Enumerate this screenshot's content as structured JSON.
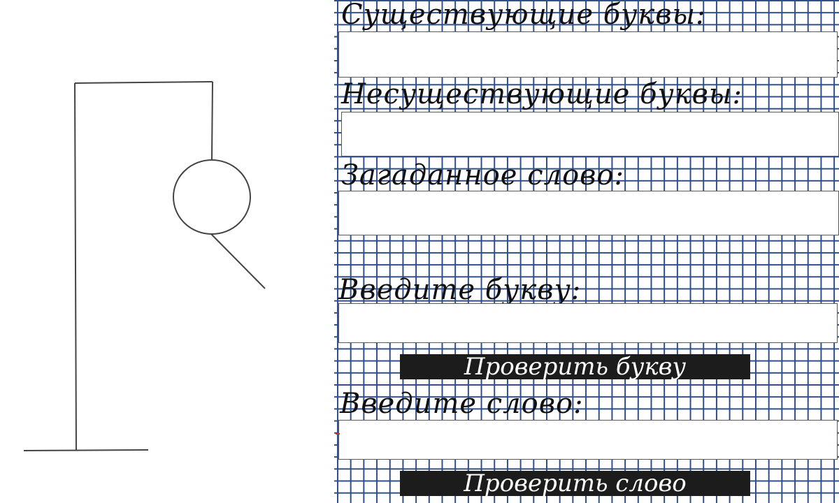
{
  "labels": {
    "existing_letters": "Существующие буквы:",
    "nonexisting_letters": "Несуществующие буквы:",
    "secret_word": "Загаданное слово:",
    "enter_letter": "Введите букву:",
    "enter_word": "Введите слово:"
  },
  "fields": {
    "existing_letters_value": "",
    "nonexisting_letters_value": "",
    "secret_word_value": "",
    "letter_input_value": "",
    "word_input_value": ""
  },
  "buttons": {
    "check_letter": "Проверить букву",
    "check_word": "Проверить слово"
  },
  "hangman": {
    "stage_parts": [
      "base",
      "pole",
      "beam",
      "rope",
      "head",
      "right-arm"
    ]
  },
  "colors": {
    "grid_line": "#2f4d86",
    "button_bg": "#1c1c1c",
    "button_text": "#ffffff",
    "drawing_stroke": "#444444"
  }
}
